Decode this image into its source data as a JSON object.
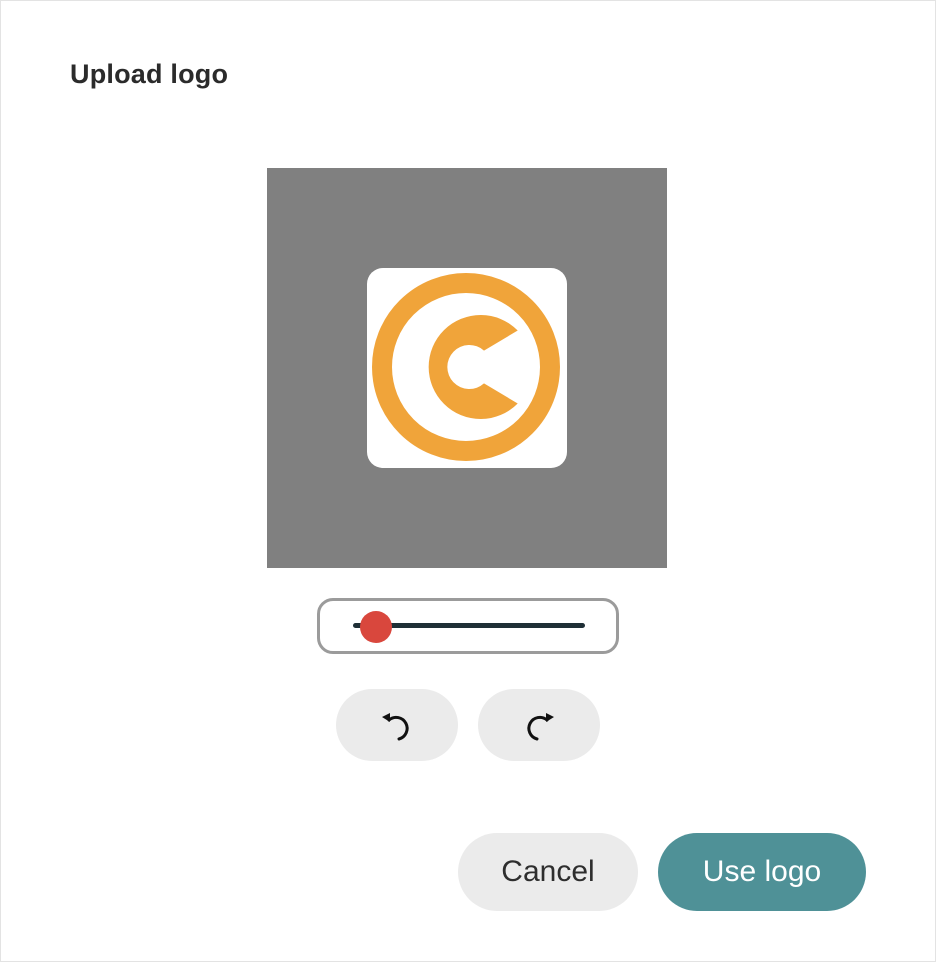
{
  "dialog": {
    "title": "Upload logo"
  },
  "cropper": {
    "background_color": "#808080",
    "logo_icon": "copyright-icon",
    "logo_color": "#F0A43A"
  },
  "zoom": {
    "value_fraction": 0.1,
    "track_color": "#1f2f36",
    "thumb_color": "#d9473d"
  },
  "rotate": {
    "left_icon": "rotate-left-icon",
    "right_icon": "rotate-right-icon"
  },
  "actions": {
    "cancel_label": "Cancel",
    "use_label": "Use logo",
    "use_color": "#4f9197"
  }
}
